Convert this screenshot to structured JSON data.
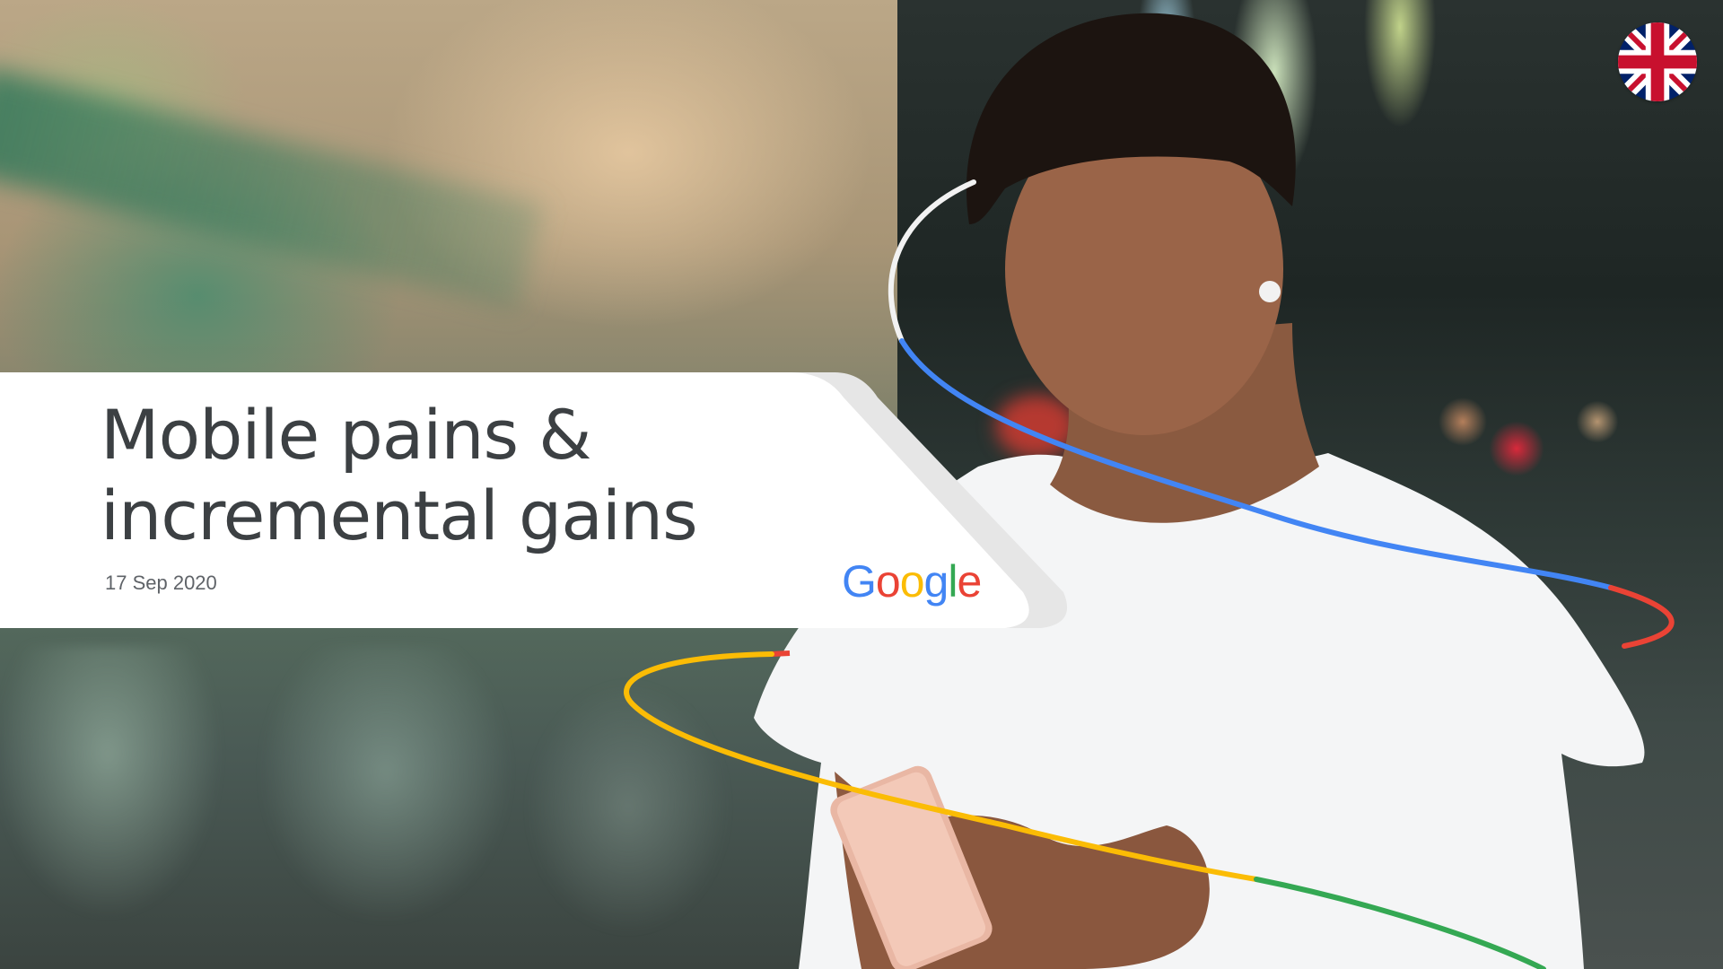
{
  "slide": {
    "title_line1": "Mobile pains &",
    "title_line2": "incremental gains",
    "date": "17 Sep 2020",
    "logo_letters": [
      {
        "char": "G",
        "color": "#4285F4"
      },
      {
        "char": "o",
        "color": "#EA4335"
      },
      {
        "char": "o",
        "color": "#FBBC05"
      },
      {
        "char": "g",
        "color": "#4285F4"
      },
      {
        "char": "l",
        "color": "#34A853"
      },
      {
        "char": "e",
        "color": "#EA4335"
      }
    ]
  },
  "flag": {
    "icon": "uk-flag-icon"
  },
  "colors": {
    "blue": "#4285F4",
    "red": "#EA4335",
    "yellow": "#FBBC05",
    "green": "#34A853",
    "title_text": "#3c4043"
  }
}
